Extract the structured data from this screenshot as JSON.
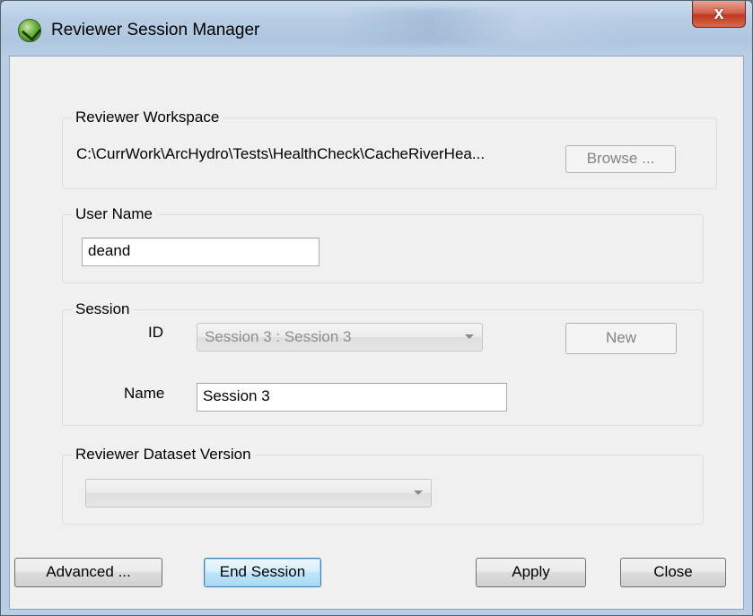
{
  "window": {
    "title": "Reviewer Session Manager",
    "close_glyph": "x",
    "app_icon": "arcgis-reviewer-icon",
    "close_icon": "close-icon"
  },
  "workspace": {
    "group_label": "Reviewer Workspace",
    "path": "C:\\CurrWork\\ArcHydro\\Tests\\HealthCheck\\CacheRiverHea...",
    "browse_label": "Browse ..."
  },
  "user": {
    "group_label": "User Name",
    "value": "deand"
  },
  "session": {
    "group_label": "Session",
    "id_label": "ID",
    "id_value": "Session 3 : Session 3",
    "new_label": "New",
    "name_label": "Name",
    "name_value": "Session 3"
  },
  "dataset": {
    "group_label": "Reviewer Dataset Version",
    "value": ""
  },
  "footer": {
    "advanced_label": "Advanced ...",
    "end_session_label": "End Session",
    "apply_label": "Apply",
    "close_label": "Close"
  },
  "colors": {
    "titlebar": "#b8cde4",
    "close_button": "#c0391f",
    "client_bg": "#f0f0f0",
    "focused_button": "#bee6fd"
  }
}
